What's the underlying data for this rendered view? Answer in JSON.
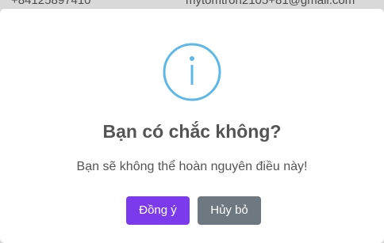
{
  "background_row": {
    "phone": "+84125897410",
    "email": "mytomtron2105+81@gmail.com"
  },
  "dialog": {
    "icon": "info-icon",
    "title": "Bạn có chắc không?",
    "message": "Bạn sẽ không thể hoàn nguyên điều này!",
    "confirm_label": "Đồng ý",
    "cancel_label": "Hủy bỏ"
  },
  "colors": {
    "icon": "#5cb8e8",
    "confirm": "#7c3aed",
    "cancel": "#6e7881",
    "text": "#545454"
  }
}
